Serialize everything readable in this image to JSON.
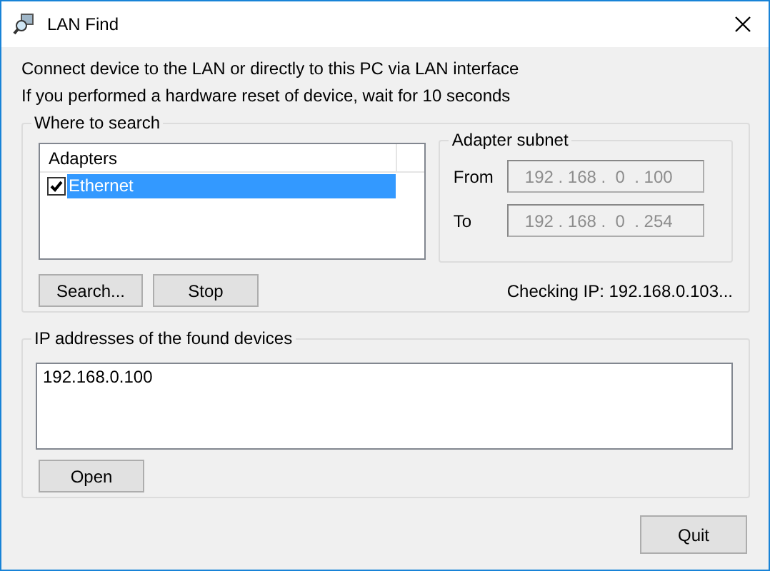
{
  "window": {
    "title": "LAN Find"
  },
  "instructions": [
    "Connect device to the LAN or directly to this PC via LAN interface",
    "If you performed a hardware reset of device, wait for 10 seconds"
  ],
  "where_to_search": {
    "title": "Where to search",
    "adapters": {
      "column": "Adapters",
      "items": [
        {
          "label": "Ethernet",
          "checked": true,
          "selected": true
        }
      ]
    },
    "subnet": {
      "title": "Adapter subnet",
      "fields": [
        {
          "label": "From",
          "value": "192 . 168 .  0  . 100",
          "disabled": true
        },
        {
          "label": "To",
          "value": "192 . 168 .  0  . 254",
          "disabled": true
        }
      ]
    },
    "buttons": [
      "Search...",
      "Stop"
    ],
    "status": "Checking IP: 192.168.0.103..."
  },
  "found_devices": {
    "title": "IP addresses of the found devices",
    "items": [
      "192.168.0.100"
    ],
    "button": "Open"
  },
  "quit_button": "Quit"
}
